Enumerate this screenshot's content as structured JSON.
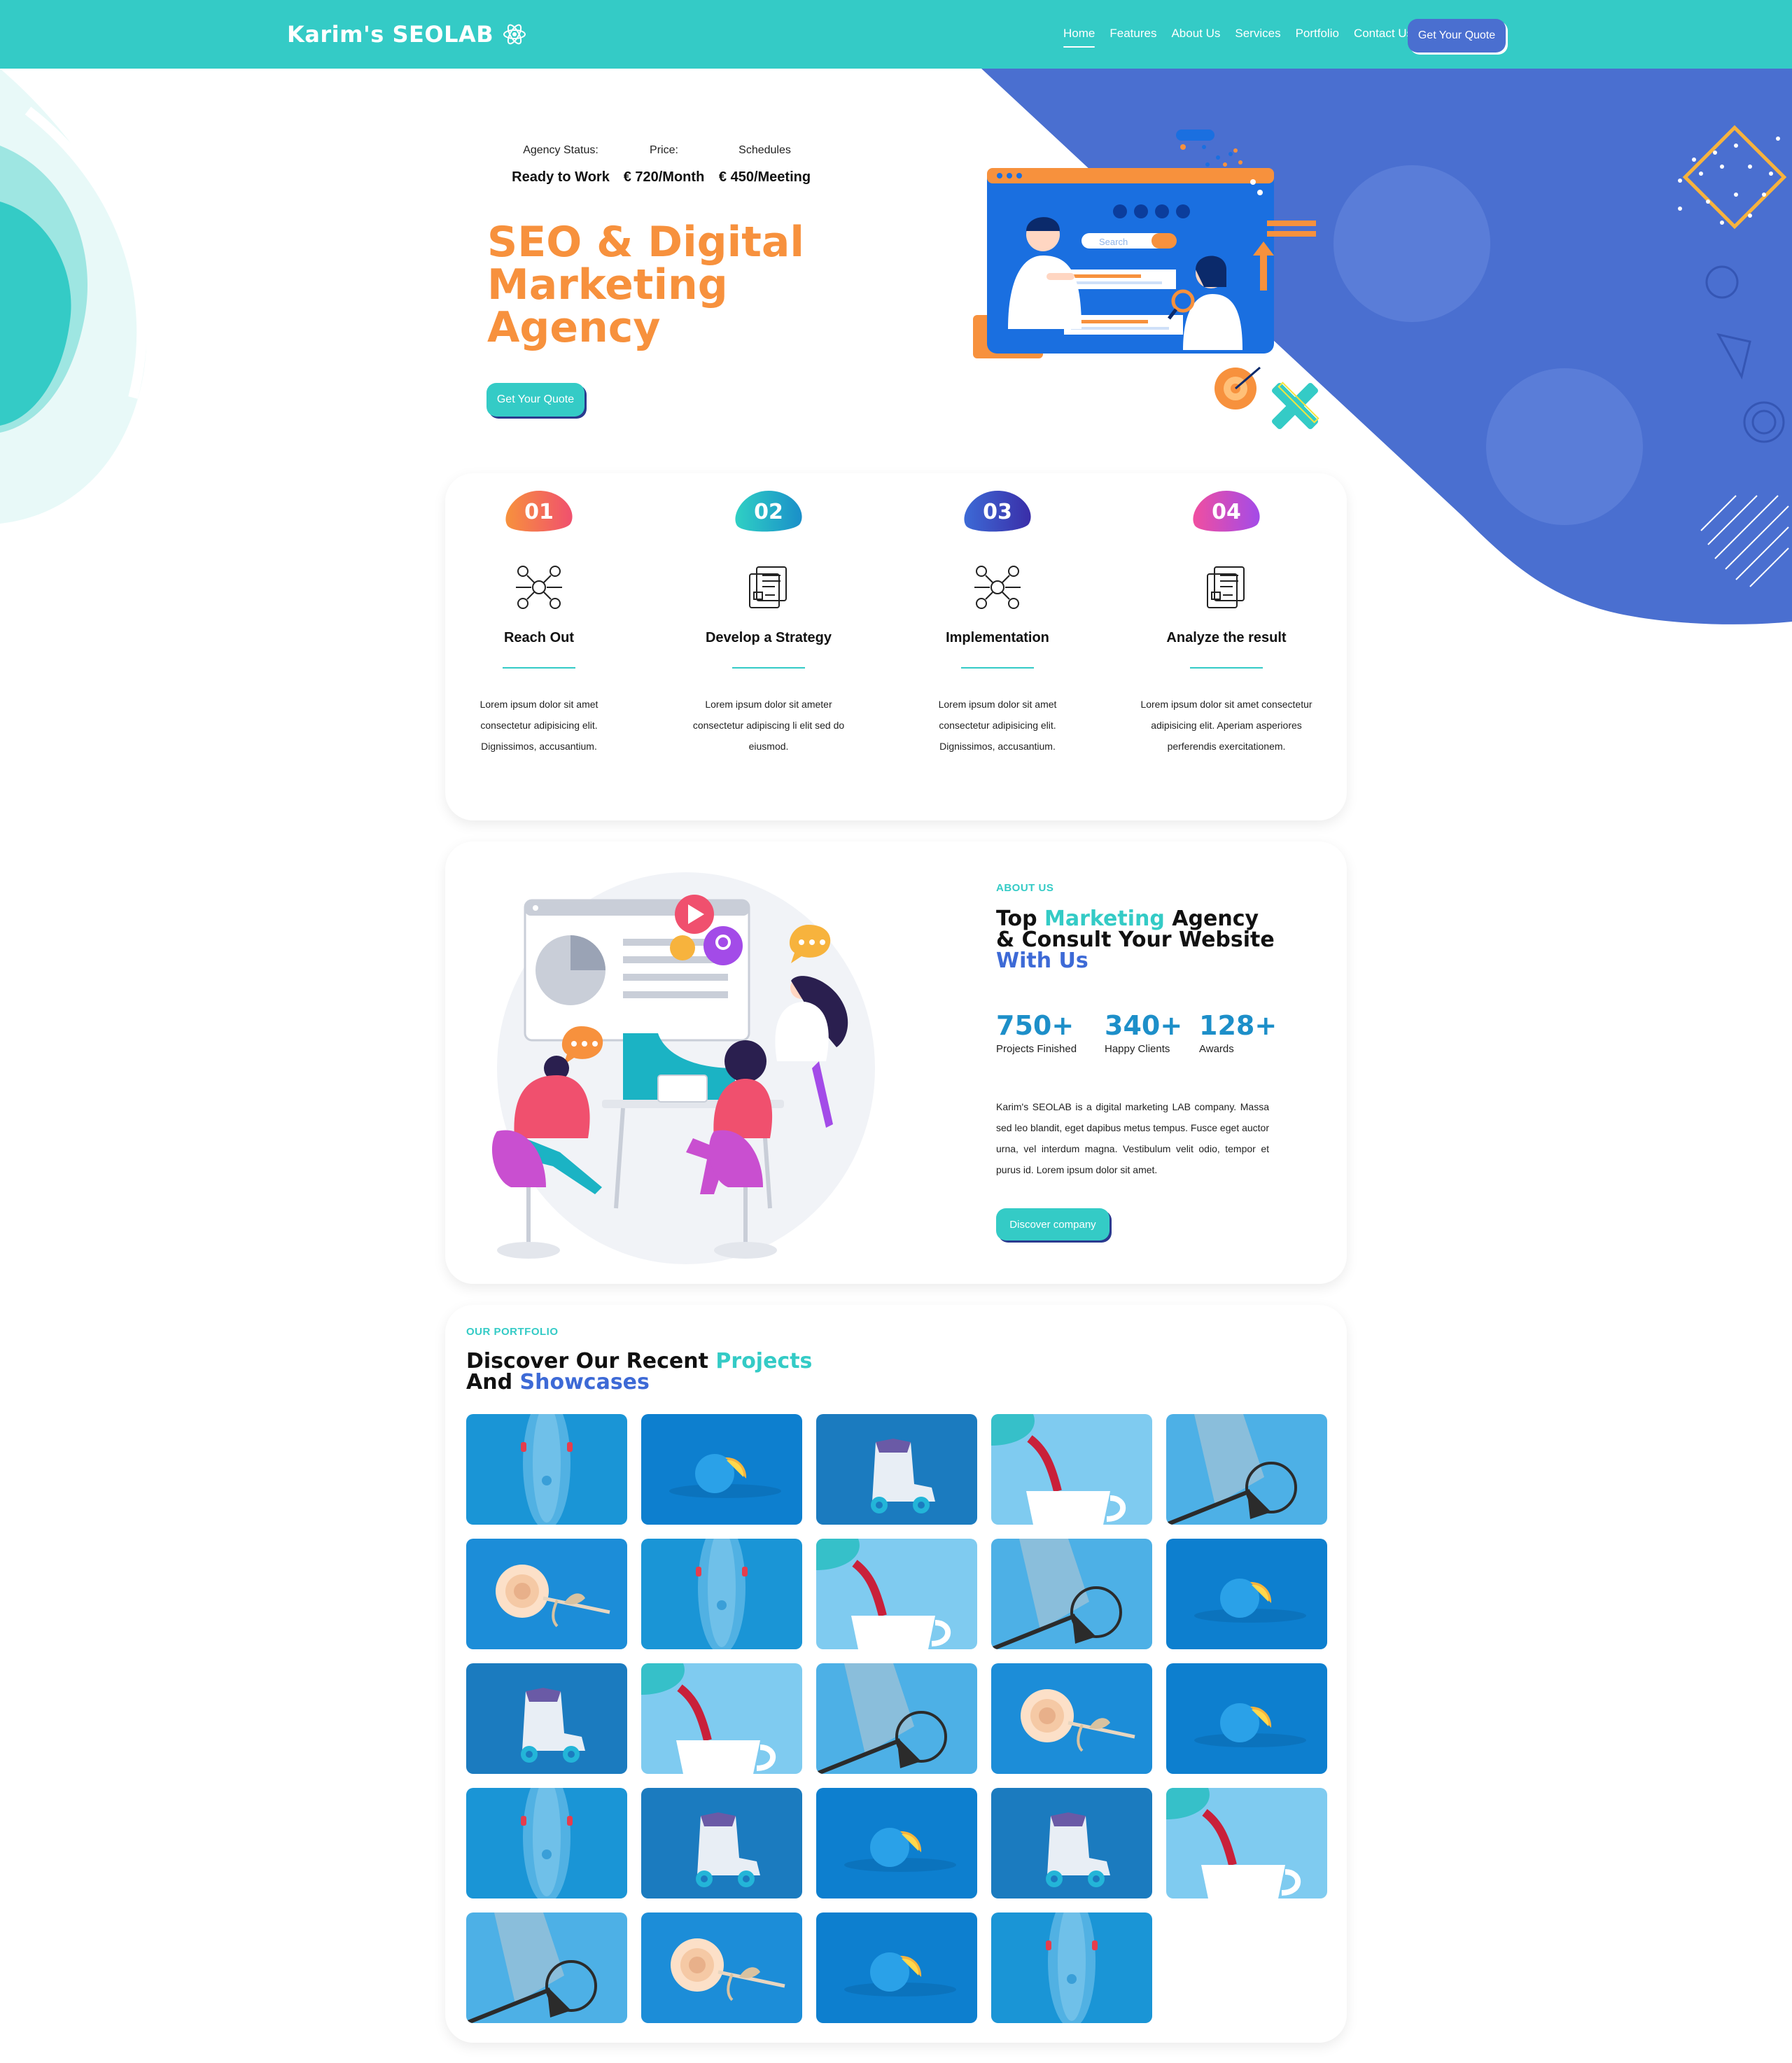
{
  "nav": {
    "brand": "Karim's SEOLAB",
    "items": [
      {
        "label": "Home",
        "active": true
      },
      {
        "label": "Features"
      },
      {
        "label": "About Us"
      },
      {
        "label": "Services"
      },
      {
        "label": "Portfolio"
      },
      {
        "label": "Contact Us"
      }
    ],
    "cta": "Get Your Quote"
  },
  "hero": {
    "stats": [
      {
        "label": "Agency Status:",
        "value": "Ready to Work"
      },
      {
        "label": "Price:",
        "value": "€ 720/Month"
      },
      {
        "label": "Schedules",
        "value": "€ 450/Meeting"
      }
    ],
    "title_lines": [
      "SEO & Digital",
      "Marketing",
      "Agency"
    ],
    "cta": "Get Your Quote",
    "illustration": {
      "search_placeholder": "Search"
    }
  },
  "steps": [
    {
      "number": "01",
      "title": "Reach Out",
      "text": "Lorem ipsum dolor sit amet consectetur adipisicing elit. Dignissimos, accusantium.",
      "icon": "network-icon",
      "color_from": "#f7913d",
      "color_to": "#f0506e"
    },
    {
      "number": "02",
      "title": "Develop a Strategy",
      "text": "Lorem ipsum dolor sit ameter consectetur adipiscing li elit sed do eiusmod.",
      "icon": "document-icon",
      "color_from": "#2fd0c4",
      "color_to": "#1a8fc9"
    },
    {
      "number": "03",
      "title": "Implementation",
      "text": "Lorem ipsum dolor sit amet consectetur adipisicing elit. Dignissimos, accusantium.",
      "icon": "network-icon",
      "color_from": "#3d6ad6",
      "color_to": "#3a2ea8"
    },
    {
      "number": "04",
      "title": "Analyze the result",
      "text": "Lorem ipsum dolor sit amet consectetur adipisicing elit. Aperiam asperiores perferendis exercitationem.",
      "icon": "document-icon",
      "color_from": "#f04ea0",
      "color_to": "#a34be8"
    }
  ],
  "about": {
    "eyebrow": "ABOUT US",
    "title": {
      "part1": "Top ",
      "part2": "Marketing",
      "part3": " Agency",
      "part4": "& Consult Your Website",
      "part5": "With Us"
    },
    "stats": [
      {
        "value": "750+",
        "label": "Projects Finished"
      },
      {
        "value": "340+",
        "label": "Happy Clients"
      },
      {
        "value": "128+",
        "label": "Awards"
      }
    ],
    "description": "Karim's SEOLAB is a digital marketing LAB company. Massa sed leo blandit, eget dapibus metus tempus. Fusce eget auctor urna, vel interdum magna. Vestibulum velit odio, tempor et purus id. Lorem ipsum dolor sit amet.",
    "cta": "Discover company"
  },
  "portfolio": {
    "eyebrow": "OUR PORTFOLIO",
    "title": {
      "part1": "Discover Our Recent ",
      "part2": "Projects",
      "part3": "And ",
      "part4": "Showcases"
    },
    "tiles": [
      "skateboard",
      "lemon-ball",
      "roller-skate",
      "teapot-cup",
      "racket",
      "rose",
      "skateboard",
      "teapot-cup",
      "racket",
      "lemon-ball",
      "roller-skate",
      "teapot-cup",
      "racket",
      "rose",
      "lemon-ball",
      "skateboard",
      "roller-skate",
      "lemon-ball",
      "roller-skate",
      "teapot-cup",
      "racket",
      "rose",
      "lemon-ball",
      "skateboard"
    ]
  },
  "colors": {
    "teal": "#34cbc6",
    "blue": "#4a6fd0",
    "orange": "#f7913d",
    "dark_blue": "#2a3a8f"
  }
}
